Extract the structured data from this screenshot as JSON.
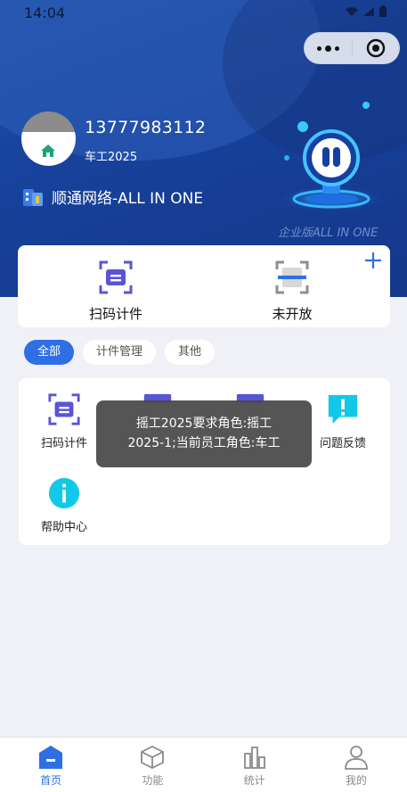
{
  "status_bar": {
    "time": "14:04"
  },
  "profile": {
    "phone": "13777983112",
    "role": "车工2025",
    "company": "顺通网络-ALL IN ONE",
    "edition": "企业版ALL IN ONE"
  },
  "quick_actions": [
    {
      "label": "扫码计件",
      "icon": "scan-icon"
    },
    {
      "label": "未开放",
      "icon": "scan-frame-icon"
    }
  ],
  "filters": [
    {
      "label": "全部",
      "active": true
    },
    {
      "label": "计件管理",
      "active": false
    },
    {
      "label": "其他",
      "active": false
    }
  ],
  "functions": [
    {
      "label": "扫码计件",
      "icon": "scan-icon"
    },
    {
      "label": "问题反馈",
      "icon": "feedback-icon"
    },
    {
      "label": "帮助中心",
      "icon": "info-icon"
    }
  ],
  "toast": {
    "line1": "摇工2025要求角色:摇工",
    "line2": "2025-1;当前员工角色:车工"
  },
  "tabbar": [
    {
      "label": "首页",
      "icon": "home-icon",
      "active": true
    },
    {
      "label": "功能",
      "icon": "cube-icon",
      "active": false
    },
    {
      "label": "统计",
      "icon": "bar-chart-icon",
      "active": false
    },
    {
      "label": "我的",
      "icon": "user-icon",
      "active": false
    }
  ],
  "colors": {
    "primary": "#2f6fe5",
    "header": "#17419a",
    "icon_purple": "#5a55d6",
    "cyan": "#12c8e8"
  }
}
